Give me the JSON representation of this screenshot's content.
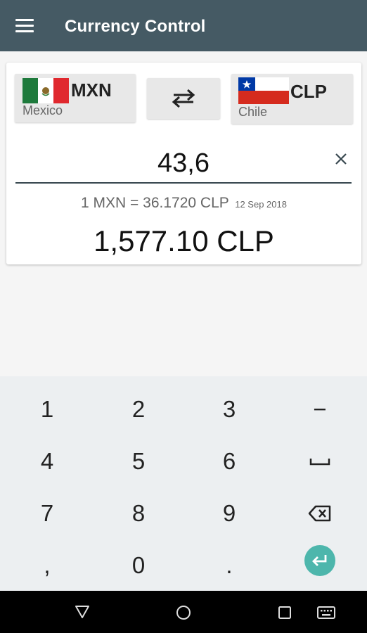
{
  "appbar": {
    "title": "Currency Control"
  },
  "from_currency": {
    "code": "MXN",
    "name": "Mexico"
  },
  "to_currency": {
    "code": "CLP",
    "name": "Chile"
  },
  "amount": {
    "value": "43,6"
  },
  "rate": {
    "text": "1 MXN = 36.1720 CLP",
    "date": "12 Sep 2018"
  },
  "result": {
    "text": "1,577.10 CLP"
  },
  "keyboard": {
    "keys": [
      "1",
      "2",
      "3",
      "−",
      "4",
      "5",
      "6",
      "7",
      "8",
      "9",
      ",",
      "0",
      "."
    ]
  },
  "colors": {
    "appbar": "#455a64",
    "accent": "#4db6ac",
    "underline": "#37474f"
  }
}
